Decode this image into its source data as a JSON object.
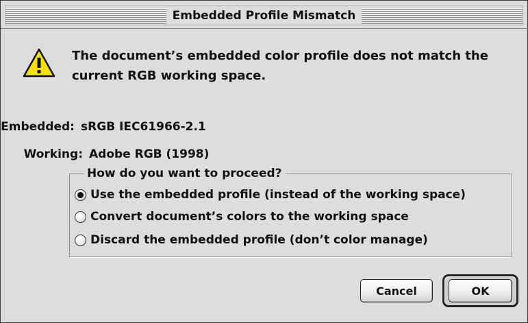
{
  "window": {
    "title": "Embedded Profile Mismatch"
  },
  "icon": "warning-icon",
  "message": "The document’s embedded color profile does not match the current RGB working space.",
  "embedded": {
    "label": "Embedded:",
    "value": "sRGB IEC61966-2.1"
  },
  "working": {
    "label": "Working:",
    "value": "Adobe RGB (1998)"
  },
  "proceed": {
    "legend": "How do you want to proceed?",
    "options": [
      {
        "label": "Use the embedded profile (instead of the working space)",
        "selected": true
      },
      {
        "label": "Convert document’s colors to the working space",
        "selected": false
      },
      {
        "label": "Discard the embedded profile (don’t color manage)",
        "selected": false
      }
    ]
  },
  "buttons": {
    "cancel": "Cancel",
    "ok": "OK"
  },
  "colors": {
    "background": "#dddddd",
    "warning_fill": "#f6e400",
    "text": "#111111"
  }
}
